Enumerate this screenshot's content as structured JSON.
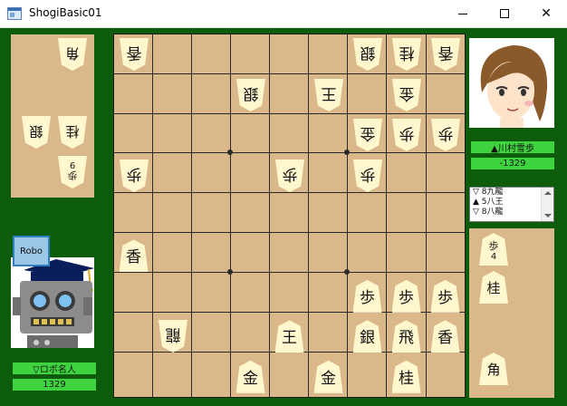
{
  "window": {
    "title": "ShogiBasic01",
    "icon": "app-form-icon"
  },
  "colors": {
    "client_background": "#0c5c0c",
    "board": "#dbb88a",
    "piece": "#fff8cf",
    "label": "#3fd43f",
    "robo_button": "#9cc6e6"
  },
  "gote_player": {
    "name": "▽ロボ名人",
    "score": "1329",
    "button_label": "Robo",
    "hand": [
      {
        "kanji": "角",
        "count": ""
      },
      {
        "kanji": "銀",
        "count": ""
      },
      {
        "kanji": "桂",
        "count": ""
      },
      {
        "kanji": "歩",
        "count": "9"
      }
    ]
  },
  "sente_player": {
    "name": "▲川村雪歩",
    "score": "-1329",
    "hand": [
      {
        "kanji": "歩",
        "count": "4"
      },
      {
        "kanji": "桂",
        "count": ""
      },
      {
        "kanji": "角",
        "count": ""
      }
    ]
  },
  "move_list": [
    "▽ 8九龍",
    "▲ 5八王",
    "▽ 8八龍"
  ],
  "board": {
    "size": 9,
    "pieces": [
      {
        "kanji": "香",
        "side": "gote",
        "col": 0,
        "row": 0
      },
      {
        "kanji": "銀",
        "side": "gote",
        "col": 6,
        "row": 0
      },
      {
        "kanji": "桂",
        "side": "gote",
        "col": 7,
        "row": 0
      },
      {
        "kanji": "香",
        "side": "gote",
        "col": 8,
        "row": 0
      },
      {
        "kanji": "銀",
        "side": "gote",
        "col": 3,
        "row": 1
      },
      {
        "kanji": "王",
        "side": "gote",
        "col": 5,
        "row": 1
      },
      {
        "kanji": "金",
        "side": "gote",
        "col": 7,
        "row": 1
      },
      {
        "kanji": "金",
        "side": "gote",
        "col": 6,
        "row": 2
      },
      {
        "kanji": "歩",
        "side": "gote",
        "col": 7,
        "row": 2
      },
      {
        "kanji": "歩",
        "side": "gote",
        "col": 8,
        "row": 2
      },
      {
        "kanji": "歩",
        "side": "gote",
        "col": 0,
        "row": 3
      },
      {
        "kanji": "歩",
        "side": "gote",
        "col": 4,
        "row": 3
      },
      {
        "kanji": "歩",
        "side": "gote",
        "col": 6,
        "row": 3
      },
      {
        "kanji": "香",
        "side": "sente",
        "col": 0,
        "row": 5
      },
      {
        "kanji": "歩",
        "side": "sente",
        "col": 6,
        "row": 6
      },
      {
        "kanji": "歩",
        "side": "sente",
        "col": 7,
        "row": 6
      },
      {
        "kanji": "歩",
        "side": "sente",
        "col": 8,
        "row": 6
      },
      {
        "kanji": "龍",
        "side": "gote",
        "col": 1,
        "row": 7
      },
      {
        "kanji": "王",
        "side": "sente",
        "col": 4,
        "row": 7
      },
      {
        "kanji": "銀",
        "side": "sente",
        "col": 6,
        "row": 7
      },
      {
        "kanji": "飛",
        "side": "sente",
        "col": 7,
        "row": 7
      },
      {
        "kanji": "香",
        "side": "sente",
        "col": 8,
        "row": 7
      },
      {
        "kanji": "金",
        "side": "sente",
        "col": 3,
        "row": 8
      },
      {
        "kanji": "金",
        "side": "sente",
        "col": 5,
        "row": 8
      },
      {
        "kanji": "桂",
        "side": "sente",
        "col": 7,
        "row": 8
      }
    ]
  },
  "portraits": {
    "gote": "robot-portrait",
    "sente": "girl-portrait"
  }
}
